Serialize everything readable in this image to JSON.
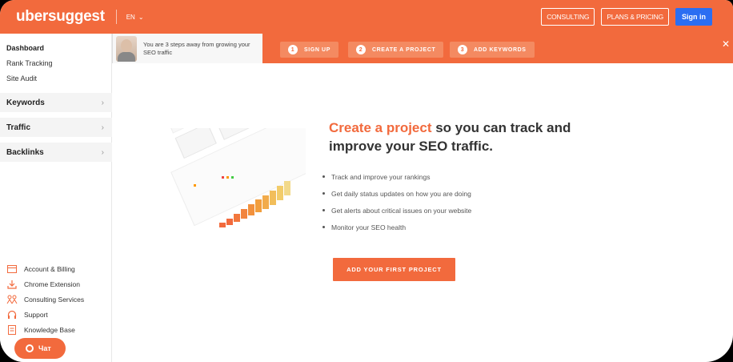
{
  "brand": {
    "logo": "ubersuggest",
    "accent": "#f26a3d",
    "signin_color": "#2b6ef2"
  },
  "topbar": {
    "language": "EN",
    "consulting": "CONSULTING",
    "plans": "PLANS & PRICING",
    "signin": "Sign in"
  },
  "sidebar": {
    "links": [
      "Dashboard",
      "Rank Tracking",
      "Site Audit"
    ],
    "sections": [
      "Keywords",
      "Traffic",
      "Backlinks"
    ],
    "bottom": [
      {
        "label": "Account & Billing",
        "icon": "credit-card-icon"
      },
      {
        "label": "Chrome Extension",
        "icon": "download-icon"
      },
      {
        "label": "Consulting Services",
        "icon": "people-icon"
      },
      {
        "label": "Support",
        "icon": "headset-icon"
      },
      {
        "label": "Knowledge Base",
        "icon": "document-icon"
      }
    ],
    "chat": "Чат"
  },
  "banner": {
    "message": "You are 3 steps away from growing your SEO traffic",
    "steps": [
      {
        "num": "1",
        "label": "SIGN UP"
      },
      {
        "num": "2",
        "label": "CREATE A PROJECT"
      },
      {
        "num": "3",
        "label": "ADD KEYWORDS"
      }
    ]
  },
  "main": {
    "title_highlight": "Create a project",
    "title_rest": " so you can track and improve your SEO traffic.",
    "bullets": [
      "Track and improve your rankings",
      "Get daily status updates on how you are doing",
      "Get alerts about critical issues on your website",
      "Monitor your SEO health"
    ],
    "cta": "ADD YOUR FIRST PROJECT"
  }
}
